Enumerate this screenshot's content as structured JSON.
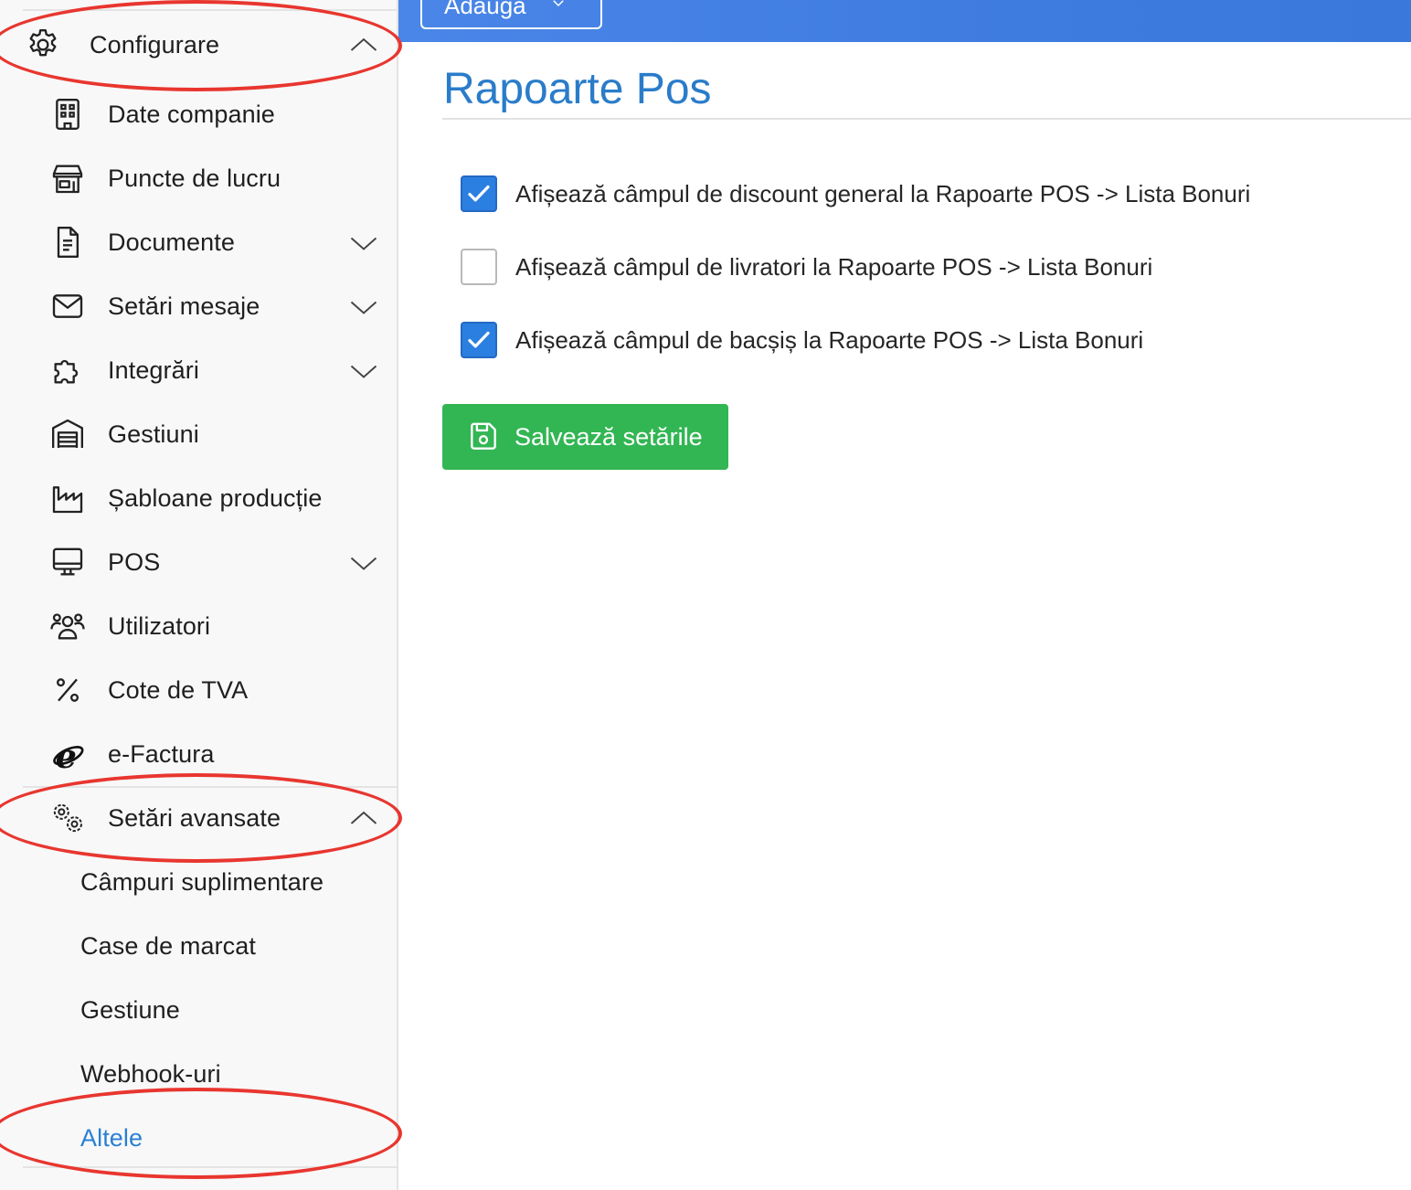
{
  "topbar": {
    "add_label": "Adaugă"
  },
  "sidebar": {
    "header": {
      "label": "Configurare",
      "icon": "gear-icon"
    },
    "items": [
      {
        "label": "Date companie",
        "icon": "building-icon",
        "expandable": false
      },
      {
        "label": "Puncte de lucru",
        "icon": "store-icon",
        "expandable": false
      },
      {
        "label": "Documente",
        "icon": "document-icon",
        "expandable": true
      },
      {
        "label": "Setări mesaje",
        "icon": "envelope-icon",
        "expandable": true
      },
      {
        "label": "Integrări",
        "icon": "puzzle-icon",
        "expandable": true
      },
      {
        "label": "Gestiuni",
        "icon": "warehouse-icon",
        "expandable": false
      },
      {
        "label": "Șabloane producție",
        "icon": "factory-icon",
        "expandable": false
      },
      {
        "label": "POS",
        "icon": "monitor-icon",
        "expandable": true
      },
      {
        "label": "Utilizatori",
        "icon": "users-icon",
        "expandable": false
      },
      {
        "label": "Cote de TVA",
        "icon": "percent-icon",
        "expandable": false
      },
      {
        "label": "e-Factura",
        "icon": "e-logo-icon",
        "expandable": false
      }
    ],
    "advanced": {
      "label": "Setări avansate",
      "icon": "gears-icon",
      "subitems": [
        {
          "label": "Câmpuri suplimentare",
          "active": false
        },
        {
          "label": "Case de marcat",
          "active": false
        },
        {
          "label": "Gestiune",
          "active": false
        },
        {
          "label": "Webhook-uri",
          "active": false
        },
        {
          "label": "Altele",
          "active": true
        }
      ]
    }
  },
  "main": {
    "title": "Rapoarte Pos",
    "options": [
      {
        "label": "Afișează câmpul de discount general la Rapoarte POS -> Lista Bonuri",
        "checked": true
      },
      {
        "label": "Afișează câmpul de livratori la Rapoarte POS -> Lista Bonuri",
        "checked": false
      },
      {
        "label": "Afișează câmpul de bacșiș la Rapoarte POS -> Lista Bonuri",
        "checked": true
      }
    ],
    "save_label": "Salvează setările"
  },
  "colors": {
    "accent_blue": "#2a7cc9",
    "topbar_blue": "#4a86e8",
    "checkbox_blue": "#2b7fe0",
    "save_green": "#32b653",
    "annotation_red": "#e8362f"
  }
}
